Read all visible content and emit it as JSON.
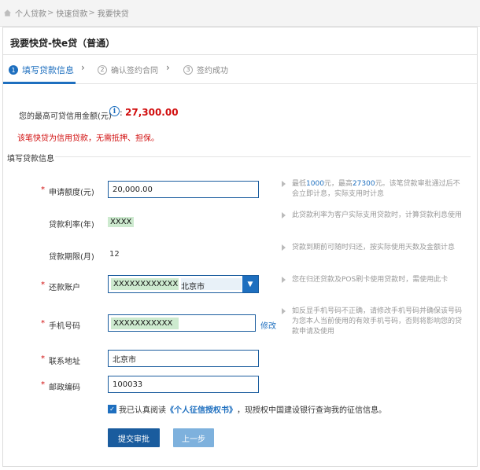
{
  "breadcrumb": {
    "items": [
      "个人贷款",
      "快速贷款",
      "我要快贷"
    ],
    "separator": ">"
  },
  "panel": {
    "title": "我要快贷-快e贷（普通）"
  },
  "steps": [
    {
      "num": "1",
      "label": "填写贷款信息",
      "active": true
    },
    {
      "num": "2",
      "label": "确认签约合同",
      "active": false
    },
    {
      "num": "3",
      "label": "签约成功",
      "active": false
    }
  ],
  "credit": {
    "label": "您的最高可贷信用金额(元)",
    "info_icon": "i",
    "colon": ":",
    "value": "27,300.00"
  },
  "notice": "该笔快贷为信用贷款，无需抵押、担保。",
  "section_title": "填写贷款信息",
  "form": {
    "amount": {
      "label": "申请额度(元)",
      "value": "20,000.00",
      "required": "*"
    },
    "rate": {
      "label": "贷款利率(年)",
      "value": "XXXX"
    },
    "term": {
      "label": "贷款期限(月)",
      "value": "12"
    },
    "account": {
      "label": "还款账户",
      "required": "*",
      "account_value": "XXXXXXXXXXXX",
      "city": "北京市"
    },
    "phone": {
      "label": "手机号码",
      "required": "*",
      "value": "XXXXXXXXXXX",
      "modify_label": "修改"
    },
    "address": {
      "label": "联系地址",
      "required": "*",
      "value": "北京市"
    },
    "postcode": {
      "label": "邮政编码",
      "required": "*",
      "value": "100033"
    }
  },
  "hints": {
    "amount": {
      "p1": "最低",
      "min": "1000",
      "p2": "元，最高",
      "max": "27300",
      "p3": "元。该笔贷款审批通过后不会立即计息，实际支用时计息"
    },
    "rate": "此贷款利率为客户实际支用贷款时，计算贷款利息使用",
    "term": "贷款到期前可随时归还，按实际使用天数及金额计息",
    "account": "您在归还贷款及POS刷卡使用贷款时，需使用此卡",
    "phone": "如反显手机号码不正确，请修改手机号码并确保该号码为您本人当前使用的有效手机号码，否则将影响您的贷款申请及使用"
  },
  "agreement": {
    "checkmark": "✓",
    "prefix": "我已认真阅读",
    "link": "《个人征信授权书》",
    "suffix": "，现授权中国建设银行查询我的征信信息。"
  },
  "buttons": {
    "submit": "提交审批",
    "back": "上一步"
  },
  "colors": {
    "accent": "#1e6fbf",
    "alert": "#d10d0d",
    "mask": "#cdeacf"
  }
}
